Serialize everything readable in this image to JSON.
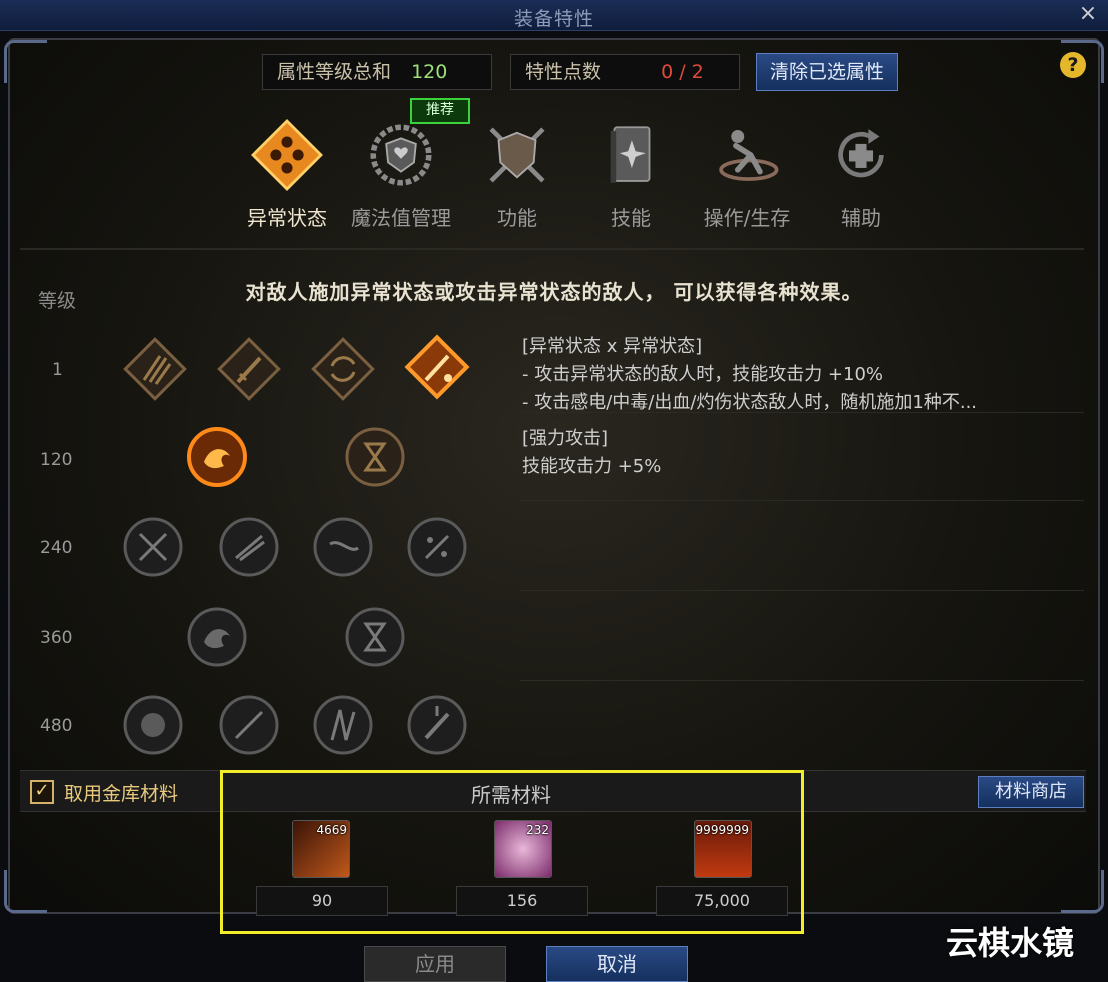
{
  "window": {
    "title": "装备特性",
    "close_glyph": "×"
  },
  "stats": {
    "total_label": "属性等级总和",
    "total_value": "120",
    "points_label": "特性点数",
    "points_value": "0 / 2",
    "clear_button": "清除已选属性",
    "help": "?"
  },
  "tabs": [
    {
      "label": "异常状态",
      "icon": "abnormal-status-icon",
      "active": true
    },
    {
      "label": "魔法值管理",
      "icon": "mana-shield-icon",
      "badge": "推荐"
    },
    {
      "label": "功能",
      "icon": "shield-swords-icon"
    },
    {
      "label": "技能",
      "icon": "skill-book-icon"
    },
    {
      "label": "操作/生存",
      "icon": "dodge-icon"
    },
    {
      "label": "辅助",
      "icon": "support-plus-icon"
    }
  ],
  "description": "对敌人施加异常状态或攻击异常状态的敌人， 可以获得各种效果。",
  "level_header": "等级",
  "levels": [
    "1",
    "120",
    "240",
    "360",
    "480"
  ],
  "effects": {
    "group1_title": "[异常状态 x 异常状态]",
    "group1_line1": "- 攻击异常状态的敌人时，技能攻击力 +10%",
    "group1_line2": "- 攻击感电/中毒/出血/灼伤状态敌人时，随机施加1种不...",
    "group2_title": "[强力攻击]",
    "group2_line1": "技能攻击力 +5%"
  },
  "footer": {
    "use_vault_label": "取用金库材料",
    "use_vault_checked": true,
    "materials_title": "所需材料",
    "shop_button": "材料商店",
    "materials": [
      {
        "icon": "orange-crystal-icon",
        "stock": "4669",
        "required": "90"
      },
      {
        "icon": "pink-orb-icon",
        "stock": "232",
        "required": "156"
      },
      {
        "icon": "gold-coins-icon",
        "stock": "9999999",
        "required": "75,000"
      }
    ],
    "apply_button": "应用",
    "cancel_button": "取消"
  },
  "watermark": "云棋水镜",
  "colors": {
    "accent_orange": "#e8891f",
    "stat_value_green": "#9ee07a",
    "points_red": "#e24a3a",
    "highlight_yellow": "#f3ec2a"
  }
}
